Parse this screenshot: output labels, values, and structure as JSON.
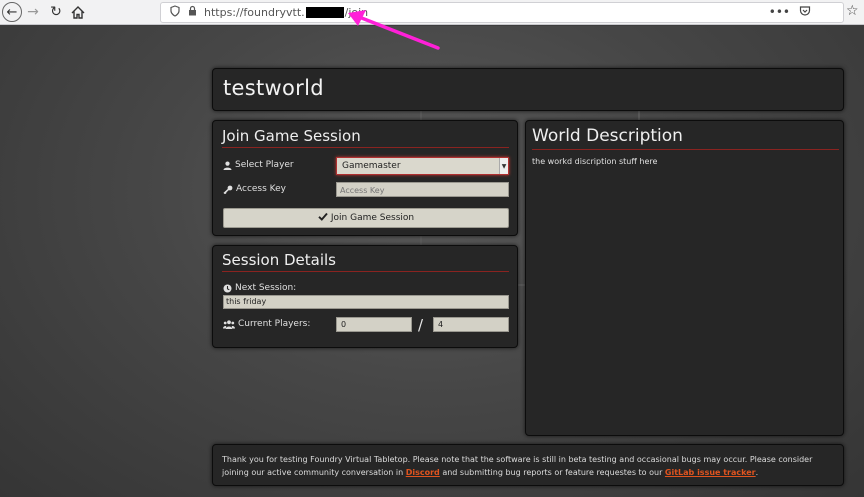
{
  "browser": {
    "url_prefix": "https://foundryvtt.",
    "url_suffix": "/join",
    "icons": [
      "back-icon",
      "forward-icon",
      "reload-icon",
      "home-icon",
      "shield-icon",
      "lock-icon",
      "more-icon",
      "pocket-icon",
      "bookmark-star-icon"
    ],
    "more_label": "•••"
  },
  "world": {
    "title": "testworld"
  },
  "join": {
    "header": "Join Game Session",
    "player_label": "Select Player",
    "player_selected": "Gamemaster",
    "key_label": "Access Key",
    "key_placeholder": "Access Key",
    "button_label": "Join Game Session"
  },
  "details": {
    "header": "Session Details",
    "next_label": "Next Session:",
    "next_value": "this friday",
    "players_label": "Current Players:",
    "players_current": "0",
    "players_sep": "/",
    "players_max": "4"
  },
  "description": {
    "header": "World Description",
    "body": "the workd discription stuff here"
  },
  "footer": {
    "text_1": "Thank you for testing Foundry Virtual Tabletop. Please note that the software is still in beta testing and occasional bugs may occur. Please consider joining our active community conversation in ",
    "link_discord": "Discord",
    "text_2": " and submitting bug reports or feature requestes to our ",
    "link_gitlab": "GitLab issue tracker",
    "text_3": "."
  },
  "colors": {
    "accent_red": "#8a2320",
    "link_orange": "#e0541f",
    "annotation_magenta": "#ff20d8"
  }
}
